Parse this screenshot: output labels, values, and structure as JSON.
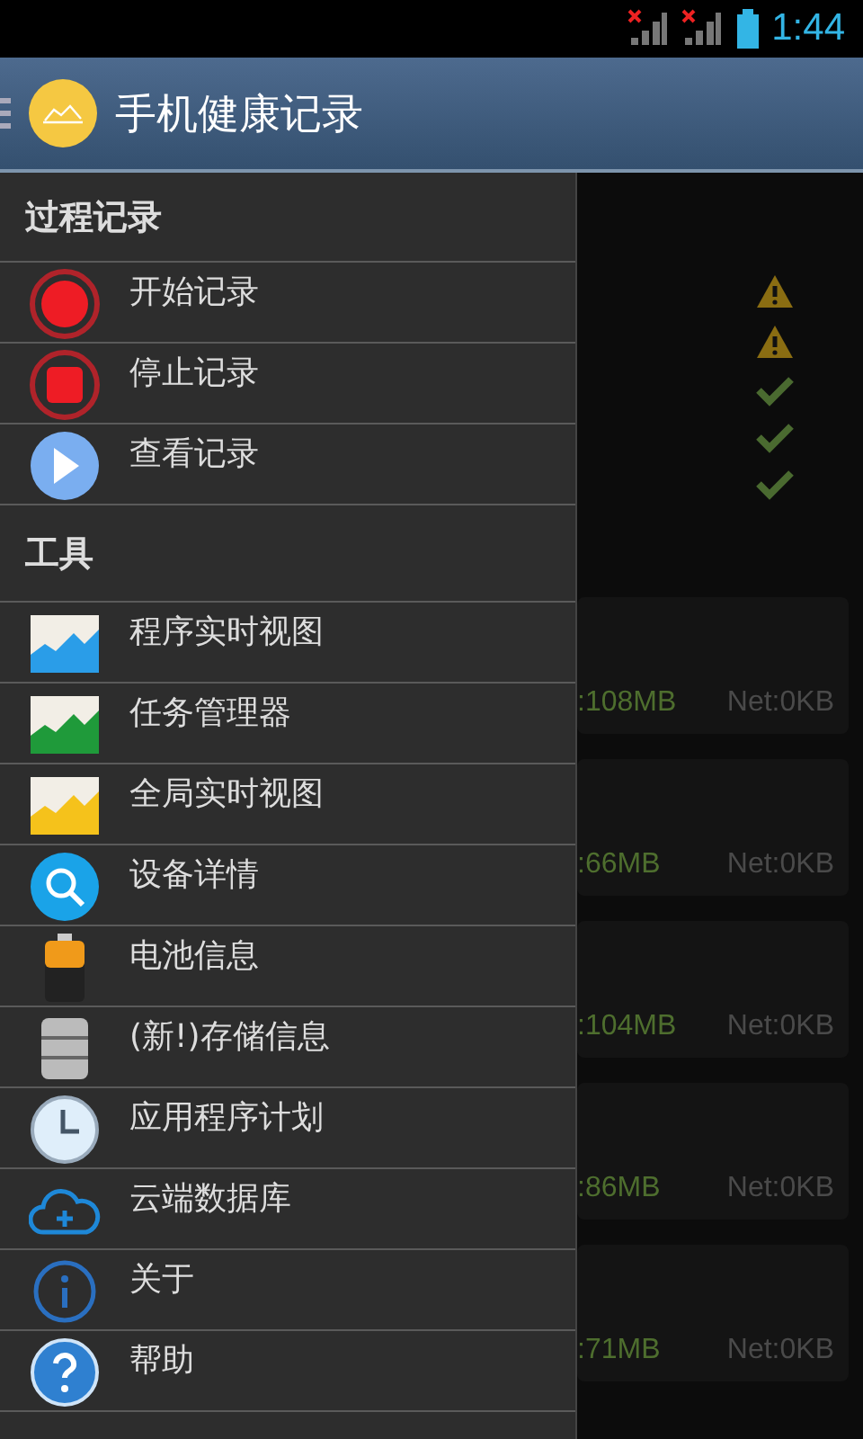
{
  "status_bar": {
    "time": "1:44"
  },
  "action_bar": {
    "title": "手机健康记录"
  },
  "drawer": {
    "sections": [
      {
        "title": "过程记录",
        "items": [
          {
            "kind": "record",
            "label": "开始记录"
          },
          {
            "kind": "stop",
            "label": "停止记录"
          },
          {
            "kind": "play",
            "label": "查看记录"
          }
        ]
      },
      {
        "title": "工具",
        "items": [
          {
            "kind": "chart-blue",
            "label": "程序实时视图"
          },
          {
            "kind": "chart-green",
            "label": "任务管理器"
          },
          {
            "kind": "chart-yellow",
            "label": "全局实时视图"
          },
          {
            "kind": "search",
            "label": "设备详情"
          },
          {
            "kind": "battery",
            "label": "电池信息"
          },
          {
            "kind": "database",
            "label": "(新!)存储信息"
          },
          {
            "kind": "clock",
            "label": "应用程序计划"
          },
          {
            "kind": "cloud",
            "label": "云端数据库"
          },
          {
            "kind": "info",
            "label": "关于"
          },
          {
            "kind": "help",
            "label": "帮助"
          }
        ]
      }
    ]
  },
  "content": {
    "alerts": [
      {
        "kind": "warning"
      },
      {
        "kind": "warning"
      },
      {
        "kind": "ok"
      },
      {
        "kind": "ok"
      },
      {
        "kind": "ok"
      }
    ],
    "cards": [
      {
        "memory": ":108MB",
        "net": "Net:0KB"
      },
      {
        "memory": ":66MB",
        "net": "Net:0KB"
      },
      {
        "memory": ":104MB",
        "net": "Net:0KB"
      },
      {
        "memory": ":86MB",
        "net": "Net:0KB"
      },
      {
        "memory": ":71MB",
        "net": "Net:0KB"
      }
    ]
  }
}
